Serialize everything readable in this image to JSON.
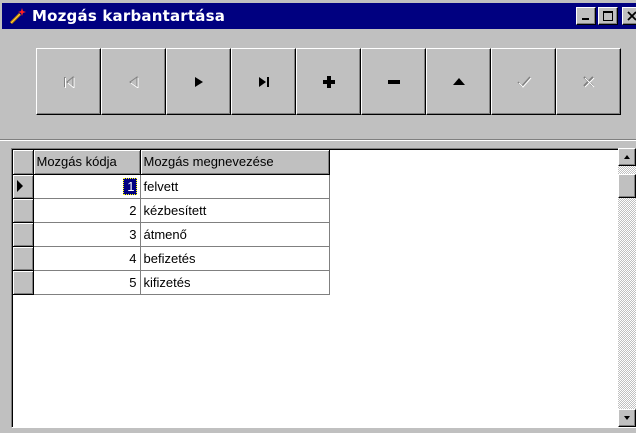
{
  "window": {
    "title": "Mozgás karbantartása",
    "icon": "wand-icon",
    "controls": [
      "minimize-icon",
      "maximize-icon",
      "close-icon"
    ]
  },
  "navigator": {
    "buttons": [
      {
        "name": "first-record",
        "icon": "first-icon",
        "enabled": false
      },
      {
        "name": "prior-record",
        "icon": "prior-icon",
        "enabled": false
      },
      {
        "name": "next-record",
        "icon": "next-icon",
        "enabled": true
      },
      {
        "name": "last-record",
        "icon": "last-icon",
        "enabled": true
      },
      {
        "name": "insert-record",
        "icon": "plus-icon",
        "enabled": true
      },
      {
        "name": "delete-record",
        "icon": "minus-icon",
        "enabled": true
      },
      {
        "name": "edit-record",
        "icon": "up-triangle-icon",
        "enabled": true
      },
      {
        "name": "post-record",
        "icon": "check-icon",
        "enabled": false
      },
      {
        "name": "cancel-record",
        "icon": "cross-icon",
        "enabled": false
      }
    ]
  },
  "grid": {
    "columns": [
      "Mozgás kódja",
      "Mozgás megnevezése"
    ],
    "rows": [
      {
        "code": "1",
        "name": "felvett"
      },
      {
        "code": "2",
        "name": "kézbesített"
      },
      {
        "code": "3",
        "name": "átmenő"
      },
      {
        "code": "4",
        "name": "befizetés"
      },
      {
        "code": "5",
        "name": "kifizetés"
      }
    ],
    "selected_row": 0
  }
}
